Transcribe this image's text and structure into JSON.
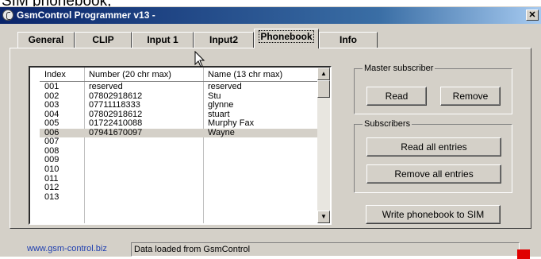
{
  "above_text": "SIM phonebook,",
  "window": {
    "title": "GsmControl Programmer v13 -",
    "close_glyph": "✕"
  },
  "tabs": [
    {
      "label": "General",
      "active": false
    },
    {
      "label": "CLIP",
      "active": false
    },
    {
      "label": "Input 1",
      "active": false
    },
    {
      "label": "Input2",
      "active": false
    },
    {
      "label": "Phonebook",
      "active": true
    },
    {
      "label": "Info",
      "active": false
    }
  ],
  "phonebook": {
    "columns": [
      "Index",
      "Number (20 chr max)",
      "Name (13 chr max)"
    ],
    "rows": [
      {
        "index": "001",
        "number": "reserved",
        "name": "reserved",
        "selected": false
      },
      {
        "index": "002",
        "number": "07802918612",
        "name": "Stu",
        "selected": false
      },
      {
        "index": "003",
        "number": "07711118333",
        "name": "glynne",
        "selected": false
      },
      {
        "index": "004",
        "number": "07802918612",
        "name": "stuart",
        "selected": false
      },
      {
        "index": "005",
        "number": "01722410088",
        "name": "Murphy Fax",
        "selected": false
      },
      {
        "index": "006",
        "number": "07941670097",
        "name": "Wayne",
        "selected": true
      },
      {
        "index": "007",
        "number": "",
        "name": "",
        "selected": false
      },
      {
        "index": "008",
        "number": "",
        "name": "",
        "selected": false
      },
      {
        "index": "009",
        "number": "",
        "name": "",
        "selected": false
      },
      {
        "index": "010",
        "number": "",
        "name": "",
        "selected": false
      },
      {
        "index": "011",
        "number": "",
        "name": "",
        "selected": false
      },
      {
        "index": "012",
        "number": "",
        "name": "",
        "selected": false
      },
      {
        "index": "013",
        "number": "",
        "name": "",
        "selected": false
      }
    ],
    "scroll_up_glyph": "▲",
    "scroll_down_glyph": "▼"
  },
  "master": {
    "label": "Master subscriber",
    "read_button": "Read",
    "remove_button": "Remove"
  },
  "subscribers": {
    "label": "Subscribers",
    "read_all_button": "Read all entries",
    "remove_all_button": "Remove all entries"
  },
  "write_button": "Write phonebook to SIM",
  "status": {
    "link": "www.gsm-control.biz",
    "message": "Data loaded from GsmControl",
    "indicator_color": "#e00000"
  },
  "colors": {
    "titlebar_start": "#0a246a",
    "titlebar_end": "#a6caf0",
    "face": "#d4d0c8",
    "selection": "#d4d0c8"
  }
}
